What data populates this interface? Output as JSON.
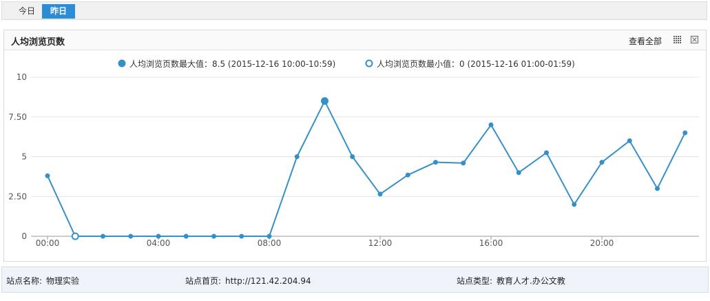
{
  "tabs": [
    {
      "label": "今日",
      "active": false
    },
    {
      "label": "昨日",
      "active": true
    }
  ],
  "panel": {
    "title": "人均浏览页数",
    "view_all": "查看全部",
    "grid_icon": "grid-icon",
    "close_icon": "close-icon"
  },
  "chart_data": {
    "type": "line",
    "title": "",
    "xlabel": "",
    "ylabel": "",
    "ylim": [
      0,
      10
    ],
    "yticks": [
      "0",
      "2.50",
      "5",
      "7.50",
      "10"
    ],
    "ytick_values": [
      0,
      2.5,
      5,
      7.5,
      10
    ],
    "xtick_labels": [
      "00:00",
      "04:00",
      "08:00",
      "12:00",
      "16:00",
      "20:00"
    ],
    "xtick_hours": [
      0,
      4,
      8,
      12,
      16,
      20
    ],
    "x": [
      0,
      1,
      2,
      3,
      4,
      5,
      6,
      7,
      8,
      9,
      10,
      11,
      12,
      13,
      14,
      15,
      16,
      17,
      18,
      19,
      20,
      21,
      22,
      23
    ],
    "values": [
      3.8,
      0,
      0,
      0,
      0,
      0,
      0,
      0,
      0,
      5,
      8.5,
      5,
      2.65,
      3.85,
      4.65,
      4.6,
      7,
      4,
      5.25,
      2,
      4.65,
      6,
      3,
      6.5
    ],
    "max_index": 10,
    "min_index": 1,
    "grid": true,
    "legend_position": "top",
    "legend": [
      {
        "marker": "filled",
        "text": "人均浏览页数最大值：8.5 (2015-12-16 10:00-10:59)"
      },
      {
        "marker": "hollow",
        "text": "人均浏览页数最小值：0 (2015-12-16 01:00-01:59)"
      }
    ],
    "colors": {
      "line": "#3590c8",
      "grid": "#e3e3e3",
      "axis": "#999999"
    }
  },
  "footer": {
    "site_name_label": "站点名称:",
    "site_name": "物理实验",
    "homepage_label": "站点首页:",
    "homepage": "http://121.42.204.94",
    "type_label": "站点类型:",
    "type": "教育人才.办公文教"
  }
}
